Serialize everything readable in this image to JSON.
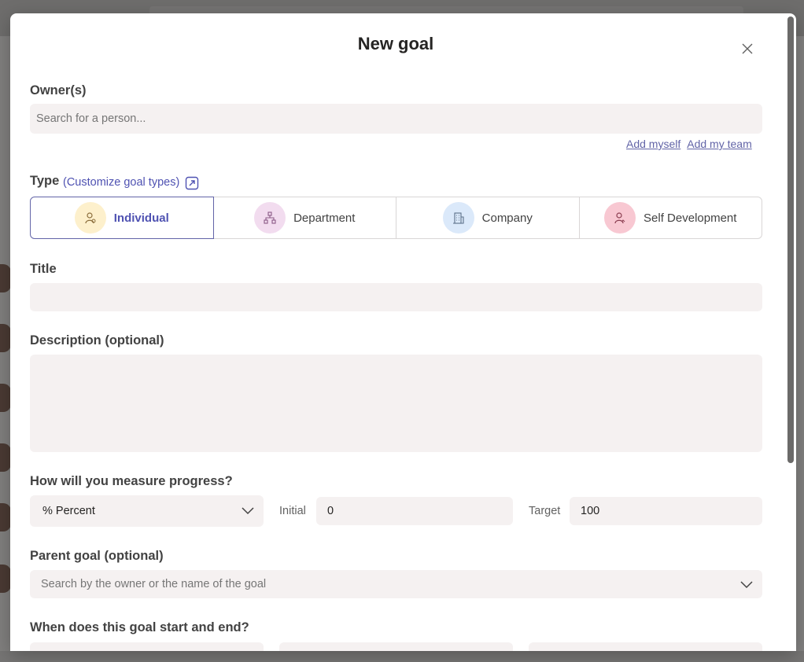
{
  "modal": {
    "title": "New goal"
  },
  "owners": {
    "label": "Owner(s)",
    "placeholder": "Search for a person...",
    "add_myself": "Add myself",
    "add_team": "Add my team"
  },
  "type": {
    "label": "Type",
    "customize": "(Customize goal types)",
    "options": [
      {
        "label": "Individual",
        "icon": "person-icon",
        "icon_bg": "#fdf0cc",
        "selected": true
      },
      {
        "label": "Department",
        "icon": "org-chart-icon",
        "icon_bg": "#f2dcef"
      },
      {
        "label": "Company",
        "icon": "building-icon",
        "icon_bg": "#dbe9fa"
      },
      {
        "label": "Self Development",
        "icon": "person-growth-icon",
        "icon_bg": "#f8c8d2"
      }
    ]
  },
  "title_field": {
    "label": "Title"
  },
  "description": {
    "label": "Description (optional)"
  },
  "measure": {
    "label": "How will you measure progress?",
    "unit": "% Percent",
    "initial_label": "Initial",
    "initial_value": "0",
    "target_label": "Target",
    "target_value": "100"
  },
  "parent": {
    "label": "Parent goal (optional)",
    "placeholder": "Search by the owner or the name of the goal"
  },
  "when": {
    "label": "When does this goal start and end?"
  },
  "colors": {
    "accent": "#6264a7",
    "input_bg": "#f5f1f1"
  }
}
